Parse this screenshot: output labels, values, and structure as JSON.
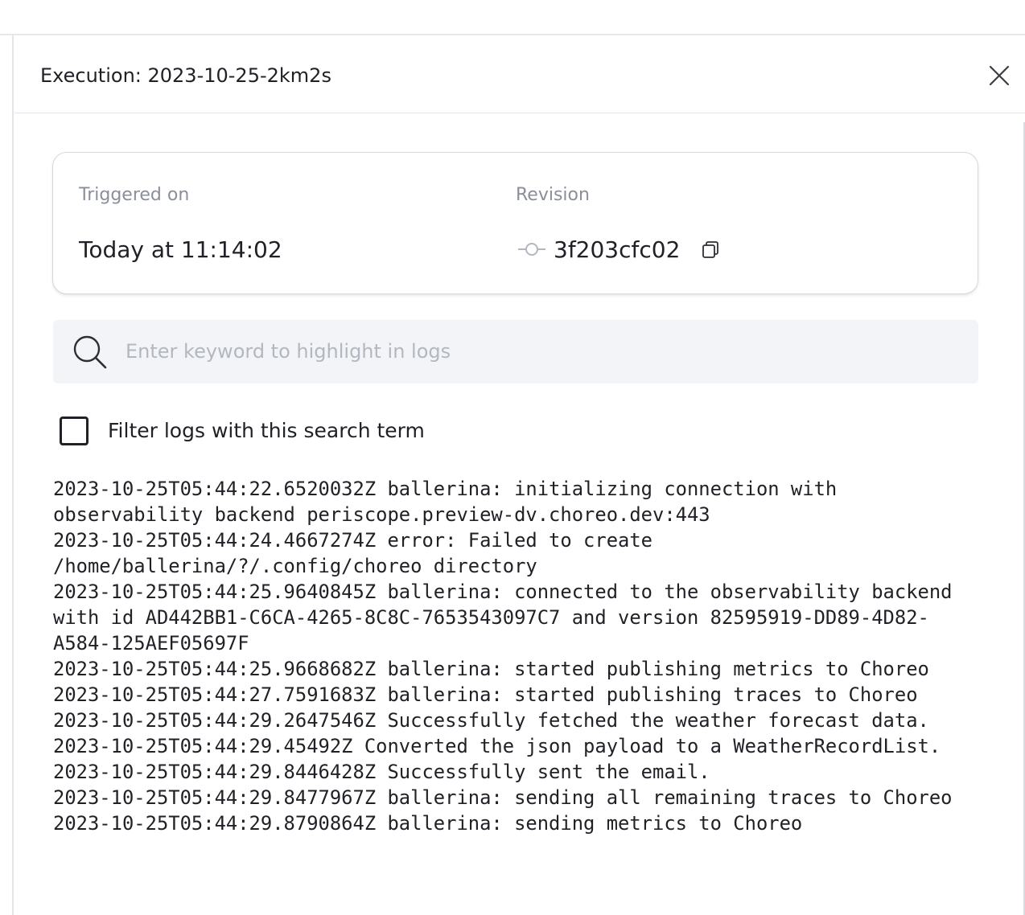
{
  "panel": {
    "title": "Execution: 2023-10-25-2km2s"
  },
  "info": {
    "triggered_label": "Triggered on",
    "triggered_value": "Today at 11:14:02",
    "revision_label": "Revision",
    "revision_value": "3f203cfc02"
  },
  "search": {
    "placeholder": "Enter keyword to highlight in logs",
    "value": ""
  },
  "filter": {
    "label": "Filter logs with this search term",
    "checked": false
  },
  "logs": [
    "2023-10-25T05:44:22.6520032Z ballerina: initializing connection with observability backend periscope.preview-dv.choreo.dev:443",
    "2023-10-25T05:44:24.4667274Z error: Failed to create /home/ballerina/?/.config/choreo directory",
    "2023-10-25T05:44:25.9640845Z ballerina: connected to the observability backend with id AD442BB1-C6CA-4265-8C8C-7653543097C7 and version 82595919-DD89-4D82-A584-125AEF05697F",
    "2023-10-25T05:44:25.9668682Z ballerina: started publishing metrics to Choreo",
    "2023-10-25T05:44:27.7591683Z ballerina: started publishing traces to Choreo",
    "2023-10-25T05:44:29.2647546Z Successfully fetched the weather forecast data.",
    "2023-10-25T05:44:29.45492Z Converted the json payload to a WeatherRecordList.",
    "2023-10-25T05:44:29.8446428Z Successfully sent the email.",
    "2023-10-25T05:44:29.8477967Z ballerina: sending all remaining traces to Choreo",
    "2023-10-25T05:44:29.8790864Z ballerina: sending metrics to Choreo"
  ]
}
